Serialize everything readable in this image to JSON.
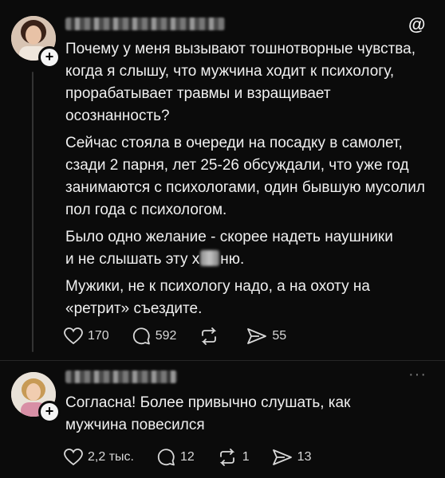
{
  "post1": {
    "paragraphs": [
      "Почему у меня вызывают тошнотворные чувства, когда я слышу, что мужчина ходит к психологу, прорабатывает травмы и взращивает осознанность?",
      "Сейчас стояла в очереди на посадку в самолет, сзади 2 парня, лет 25-26 обсуждали, что уже год занимаются с психологами, один бывшую мусолил пол года с психологом.",
      "Было одно желание - скорее надеть наушники"
    ],
    "line_censored_pre": "и не слышать эту х",
    "line_censored_post": "ню.",
    "last_paragraph": "Мужики, не к психологу надо, а на охоту на «ретрит» съездите.",
    "likes": "170",
    "comments": "592",
    "shares": "55"
  },
  "post2": {
    "text": "Согласна! Более привычно слушать, как мужчина повесился",
    "likes": "2,2 тыс.",
    "comments": "12",
    "reposts": "1",
    "shares": "13"
  },
  "icons": {
    "logo": "threads-logo-icon",
    "more": "more-dots-icon"
  },
  "colors": {
    "background": "#0b0b0b",
    "text": "#f0f0f0",
    "muted": "#7a7a7a"
  }
}
